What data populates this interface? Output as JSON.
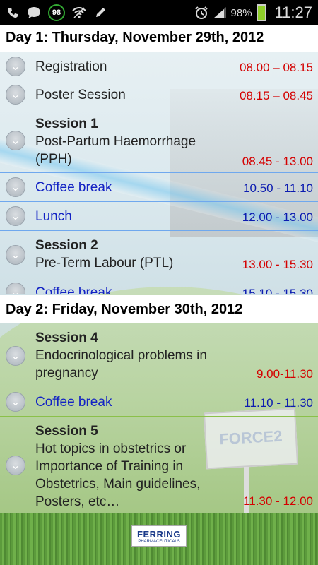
{
  "status_bar": {
    "badge": "98",
    "battery_pct": "98%",
    "time": "11:27",
    "battery_level": 0.98
  },
  "day1": {
    "header": "Day 1: Thursday, November 29th, 2012",
    "rows": [
      {
        "title": "",
        "label": "Registration",
        "time": "08.00 – 08.15",
        "color": "red"
      },
      {
        "title": "",
        "label": "Poster Session",
        "time": "08.15 – 08.45",
        "color": "red"
      },
      {
        "title": "Session 1",
        "label": "Post-Partum Haemorrhage (PPH)",
        "time": "08.45 - 13.00",
        "color": "red"
      },
      {
        "title": "",
        "label": "Coffee break",
        "time": "10.50 - 11.10",
        "color": "blue"
      },
      {
        "title": "",
        "label": "Lunch",
        "time": "12.00 - 13.00",
        "color": "blue"
      },
      {
        "title": "Session 2",
        "label": "Pre-Term Labour (PTL)",
        "time": "13.00 - 15.30",
        "color": "red"
      },
      {
        "title": "",
        "label": "Coffee break",
        "time": "15.10 - 15.30",
        "color": "blue"
      }
    ]
  },
  "day2": {
    "header": "Day 2: Friday, November 30th, 2012",
    "rows": [
      {
        "title": "Session 4",
        "label": "Endocrinological problems in pregnancy",
        "time": "9.00-11.30",
        "color": "red"
      },
      {
        "title": "",
        "label": "Coffee break",
        "time": "11.10 - 11.30",
        "color": "blue"
      },
      {
        "title": "Session 5",
        "label": "Hot topics in obstetrics or Importance of Training in Obstetrics, Main guidelines, Posters, etc…",
        "time": "11.30 - 12.00",
        "color": "red"
      }
    ]
  },
  "background": {
    "sign_text": "FORCE2"
  },
  "footer": {
    "logo_line1": "FERRING",
    "logo_line2": "PHARMACEUTICALS"
  }
}
